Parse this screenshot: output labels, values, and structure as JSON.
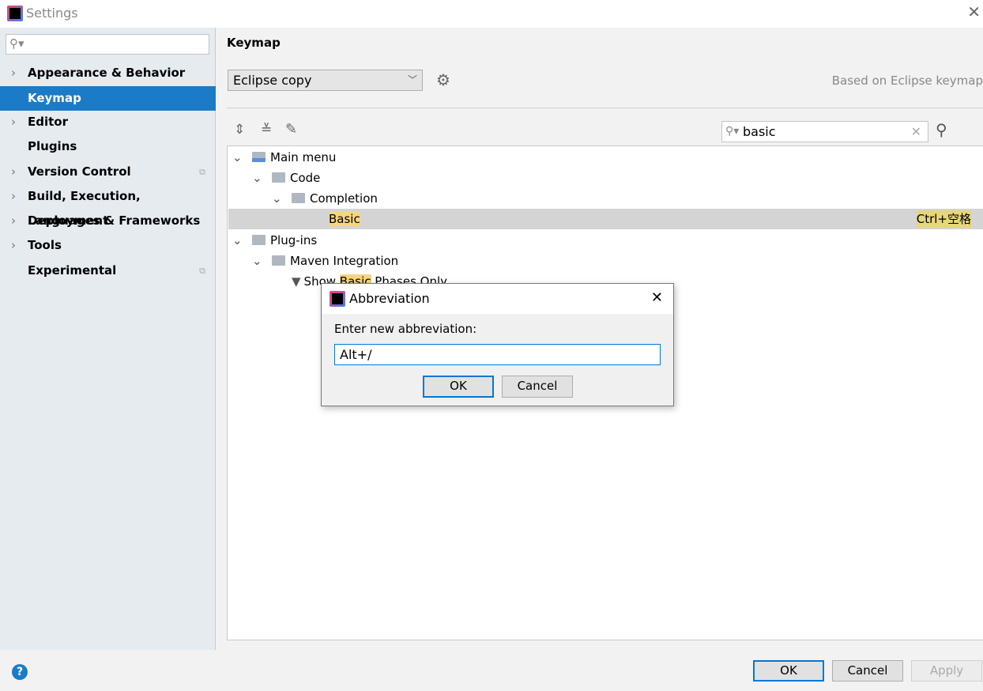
{
  "window": {
    "title": "Settings"
  },
  "sidebar": {
    "search_placeholder": "",
    "items": [
      {
        "label": "Appearance & Behavior",
        "expandable": true
      },
      {
        "label": "Keymap",
        "selected": true
      },
      {
        "label": "Editor",
        "expandable": true
      },
      {
        "label": "Plugins"
      },
      {
        "label": "Version Control",
        "expandable": true
      },
      {
        "label": "Build, Execution, Deployment",
        "expandable": true
      },
      {
        "label": "Languages & Frameworks",
        "expandable": true
      },
      {
        "label": "Tools",
        "expandable": true
      },
      {
        "label": "Experimental"
      }
    ]
  },
  "keymap": {
    "title": "Keymap",
    "selected_keymap": "Eclipse copy",
    "based_on": "Based on Eclipse keymap",
    "search_value": "basic",
    "tree": [
      {
        "label": "Main menu",
        "level": 0
      },
      {
        "label": "Code",
        "level": 1
      },
      {
        "label": "Completion",
        "level": 2
      },
      {
        "label": "Basic",
        "level": 3,
        "shortcut": "Ctrl+空格",
        "selected": true
      },
      {
        "label": "Plug-ins",
        "level": 0
      },
      {
        "label": "Maven Integration",
        "level": 1
      },
      {
        "pre": "Show ",
        "match": "Basic",
        "post": " Phases Only",
        "level": 2
      }
    ]
  },
  "dialog": {
    "title": "Abbreviation",
    "prompt": "Enter new abbreviation:",
    "value": "Alt+/",
    "ok": "OK",
    "cancel": "Cancel"
  },
  "footer": {
    "help": "?",
    "ok": "OK",
    "cancel": "Cancel",
    "apply": "Apply"
  },
  "colors": {
    "accent": "#1c7bc6",
    "highlight": "#f6d57d",
    "selected_row": "#d4d4d4"
  }
}
